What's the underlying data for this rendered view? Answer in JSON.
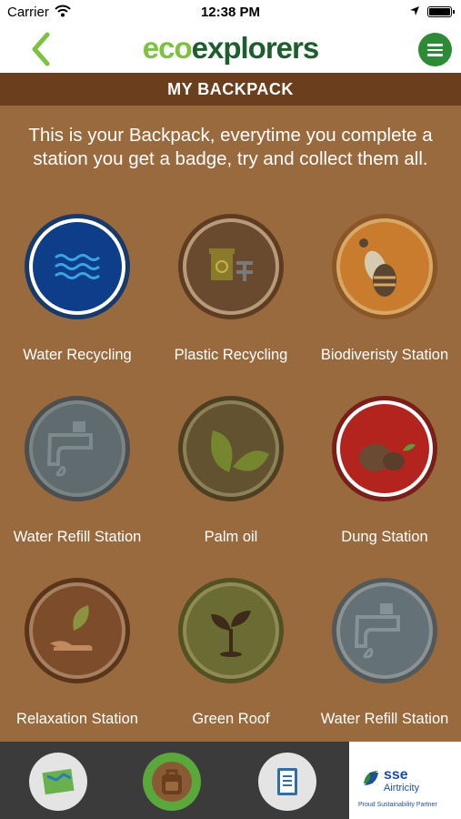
{
  "status": {
    "carrier": "Carrier",
    "time": "12:38 PM"
  },
  "header": {
    "logo_part1": "eco",
    "logo_part2": "explorers",
    "back_icon": "chevron-left-icon",
    "menu_icon": "hamburger-icon"
  },
  "title": "MY BACKPACK",
  "intro": "This is your Backpack, everytime you complete a station you get a badge, try and collect them all.",
  "badges": [
    {
      "label": "Water Recycling",
      "icon": "water-waves-icon",
      "color": "#0e3d8a",
      "earned": true
    },
    {
      "label": "Plastic Recycling",
      "icon": "recycle-bin-icon",
      "color": "#6a4a2f",
      "earned": false
    },
    {
      "label": "Biodiveristy Station",
      "icon": "bee-icon",
      "color": "#c97c2d",
      "earned": true
    },
    {
      "label": "Water Refill Station",
      "icon": "tap-icon",
      "color": "#5f6b6e",
      "earned": false
    },
    {
      "label": "Palm oil",
      "icon": "leaves-icon",
      "color": "#63522f",
      "earned": false
    },
    {
      "label": "Dung Station",
      "icon": "dung-icon",
      "color": "#b3241f",
      "earned": true
    },
    {
      "label": "Relaxation Station",
      "icon": "hand-plant-icon",
      "color": "#7d4c2a",
      "earned": false
    },
    {
      "label": "Green Roof",
      "icon": "sprout-icon",
      "color": "#6b6c33",
      "earned": false
    },
    {
      "label": "Water Refill Station",
      "icon": "tap-icon",
      "color": "#647176",
      "earned": false
    }
  ],
  "tabbar": {
    "tabs": [
      {
        "icon": "map-icon",
        "active": false
      },
      {
        "icon": "backpack-icon",
        "active": true
      },
      {
        "icon": "clipboard-icon",
        "active": false
      }
    ],
    "sponsor": {
      "name": "sse",
      "name2": "Airtricity",
      "tagline": "Proud Sustainability Partner"
    }
  },
  "colors": {
    "brand_light": "#7cc23f",
    "brand_dark": "#1d5e2e",
    "background": "#9a6a3f",
    "titlebar": "#6b3f1d"
  }
}
